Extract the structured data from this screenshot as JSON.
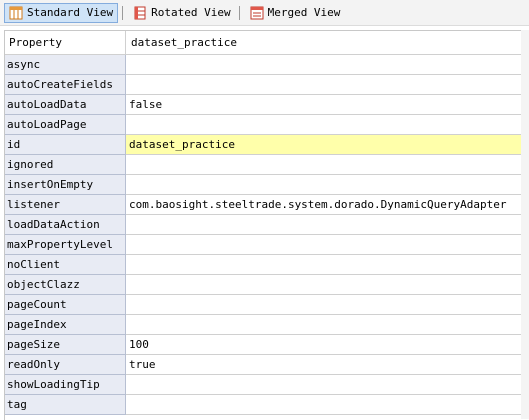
{
  "toolbar": {
    "tabs": [
      {
        "label": "Standard View",
        "icon": "grid-view-icon"
      },
      {
        "label": "Rotated View",
        "icon": "rotated-view-icon"
      },
      {
        "label": "Merged View",
        "icon": "merged-view-icon"
      }
    ],
    "active_tab": "Standard View"
  },
  "table": {
    "header": {
      "property": "Property",
      "value": "dataset_practice"
    },
    "rows": [
      {
        "name": "async",
        "value": ""
      },
      {
        "name": "autoCreateFields",
        "value": ""
      },
      {
        "name": "autoLoadData",
        "value": "false"
      },
      {
        "name": "autoLoadPage",
        "value": ""
      },
      {
        "name": "id",
        "value": "dataset_practice"
      },
      {
        "name": "ignored",
        "value": ""
      },
      {
        "name": "insertOnEmpty",
        "value": ""
      },
      {
        "name": "listener",
        "value": "com.baosight.steeltrade.system.dorado.DynamicQueryAdapter"
      },
      {
        "name": "loadDataAction",
        "value": ""
      },
      {
        "name": "maxPropertyLevel",
        "value": ""
      },
      {
        "name": "noClient",
        "value": ""
      },
      {
        "name": "objectClazz",
        "value": ""
      },
      {
        "name": "pageCount",
        "value": ""
      },
      {
        "name": "pageIndex",
        "value": ""
      },
      {
        "name": "pageSize",
        "value": "100"
      },
      {
        "name": "readOnly",
        "value": "true"
      },
      {
        "name": "showLoadingTip",
        "value": ""
      },
      {
        "name": "tag",
        "value": ""
      }
    ]
  },
  "colors": {
    "highlight": "#ffffaa",
    "active_tab_bg": "#cfe3f7",
    "name_column_bg": "#e8ebf4"
  }
}
